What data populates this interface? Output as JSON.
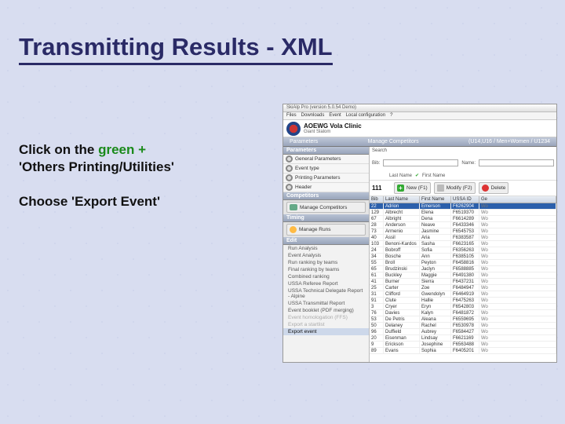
{
  "slide": {
    "title": "Transmitting Results - XML",
    "line1_prefix": "Click on the ",
    "line1_green": "green +",
    "line2": "'Others Printing/Utilities'",
    "line3": "Choose 'Export Event'"
  },
  "app": {
    "titlebar": "SkiAlp Pro (version 5.0.54 Demo)",
    "menus": [
      "Files",
      "Downloads",
      "Event",
      "Local configuration",
      "?"
    ],
    "header_title": "AOEWG Vola Clinic",
    "header_sub": "Giant Slalom",
    "tabs_left": "Parameters",
    "tabs_mid": "Manage Competitors",
    "tabs_right": "(U14,U16 / Men+Women / U1234",
    "sections": {
      "parameters": "Parameters",
      "competitors": "Competitors",
      "timing": "Timing",
      "edit": "Edit"
    },
    "param_items": [
      "General Parameters",
      "Event type",
      "Printing Parameters",
      "Header"
    ],
    "comp_button": "Manage Competitors",
    "timing_button": "Manage Runs",
    "action_new": "New (F1)",
    "action_modify": "Modify (F2)",
    "action_delete": "Delete",
    "edit_items": [
      {
        "label": "Run Analysis",
        "dim": false
      },
      {
        "label": "Event Analysis",
        "dim": false
      },
      {
        "label": "Run ranking by teams",
        "dim": false
      },
      {
        "label": "Final ranking by teams",
        "dim": false
      },
      {
        "label": "Combined ranking",
        "dim": false
      },
      {
        "label": "USSA Referee Report",
        "dim": false
      },
      {
        "label": "USSA Technical Delegate Report - Alpine",
        "dim": false
      },
      {
        "label": "USSA Transmittal Report",
        "dim": false
      },
      {
        "label": "Event booklet (PDF merging)",
        "dim": false
      },
      {
        "label": "Event homologation (FFS)",
        "dim": true
      },
      {
        "label": "Export a startlist",
        "dim": true
      },
      {
        "label": "Export event",
        "dim": false,
        "sel": true
      }
    ],
    "search": {
      "label": "Search",
      "bib": "Bib:",
      "name": "Name:",
      "lastname": "Last Name",
      "firstname": "First Name"
    },
    "count": "111",
    "columns": {
      "bib": "Bib",
      "ln": "Last Name",
      "fn": "First Name",
      "id": "USSA ID",
      "ge": "Ge"
    },
    "rows": [
      {
        "bib": "22",
        "ln": "Adrion",
        "fn": "Emerson",
        "id": "F6262904",
        "ge": "Wo",
        "sel": true
      },
      {
        "bib": "129",
        "ln": "Albrecht",
        "fn": "Elena",
        "id": "F6519370",
        "ge": "Wo"
      },
      {
        "bib": "67",
        "ln": "Albright",
        "fn": "Dena",
        "id": "F6614289",
        "ge": "Wo"
      },
      {
        "bib": "28",
        "ln": "Anderson",
        "fn": "Neave",
        "id": "F6433346",
        "ge": "Wo"
      },
      {
        "bib": "73",
        "ln": "Armenio",
        "fn": "Jasmine",
        "id": "F6545753",
        "ge": "Wo"
      },
      {
        "bib": "40",
        "ln": "Assil",
        "fn": "Aria",
        "id": "F6383587",
        "ge": "Wo"
      },
      {
        "bib": "103",
        "ln": "Benoni-Kardos",
        "fn": "Sasha",
        "id": "F6623165",
        "ge": "Wo"
      },
      {
        "bib": "24",
        "ln": "Bobroff",
        "fn": "Sofia",
        "id": "F6356263",
        "ge": "Wo"
      },
      {
        "bib": "34",
        "ln": "Bosche",
        "fn": "Ann",
        "id": "F6385105",
        "ge": "Wo"
      },
      {
        "bib": "55",
        "ln": "Broll",
        "fn": "Peyton",
        "id": "F6458816",
        "ge": "Wo"
      },
      {
        "bib": "65",
        "ln": "Brudzinski",
        "fn": "Jaclyn",
        "id": "F6588885",
        "ge": "Wo"
      },
      {
        "bib": "61",
        "ln": "Buckley",
        "fn": "Maggie",
        "id": "F6491380",
        "ge": "Wo"
      },
      {
        "bib": "41",
        "ln": "Burner",
        "fn": "Sierra",
        "id": "F6437231",
        "ge": "Wo"
      },
      {
        "bib": "25",
        "ln": "Carter",
        "fn": "Zoe",
        "id": "F6484947",
        "ge": "Wo"
      },
      {
        "bib": "31",
        "ln": "Clifford",
        "fn": "Gwendolyn",
        "id": "F6464919",
        "ge": "Wo"
      },
      {
        "bib": "91",
        "ln": "Clute",
        "fn": "Hallie",
        "id": "F6475263",
        "ge": "Wo"
      },
      {
        "bib": "3",
        "ln": "Cryer",
        "fn": "Eryn",
        "id": "F6542803",
        "ge": "Wo"
      },
      {
        "bib": "76",
        "ln": "Davies",
        "fn": "Kalyn",
        "id": "F6481872",
        "ge": "Wo"
      },
      {
        "bib": "53",
        "ln": "De Petris",
        "fn": "Aleana",
        "id": "F6559695",
        "ge": "Wo"
      },
      {
        "bib": "50",
        "ln": "Delaney",
        "fn": "Rachel",
        "id": "F6530978",
        "ge": "Wo"
      },
      {
        "bib": "96",
        "ln": "Duffield",
        "fn": "Aubrey",
        "id": "F6584427",
        "ge": "Wo"
      },
      {
        "bib": "20",
        "ln": "Eisenman",
        "fn": "Lindsay",
        "id": "F6621169",
        "ge": "Wo"
      },
      {
        "bib": "9",
        "ln": "Erickson",
        "fn": "Josephine",
        "id": "F6563488",
        "ge": "Wo"
      },
      {
        "bib": "89",
        "ln": "Evans",
        "fn": "Sophia",
        "id": "F6405201",
        "ge": "Wo"
      }
    ]
  }
}
